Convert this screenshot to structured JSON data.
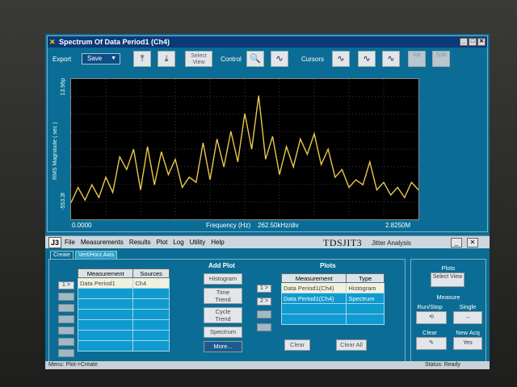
{
  "window": {
    "title": "Spectrum Of Data Period1 (Ch4)",
    "controls": [
      "_",
      "□",
      "✕"
    ]
  },
  "toolbar": {
    "export_label": "Export",
    "export_value": "Save",
    "select_view": "Select View",
    "control_label": "Control",
    "cursors_label": "Cursors",
    "var_label": "Var",
    "split_label": "Split"
  },
  "chart_data": {
    "type": "line",
    "xlabel": "Frequency (Hz)",
    "x_scale": "262.50kHz/div",
    "x_start": "0.0000",
    "x_end": "2.8250M",
    "ylabel": "RMS Magnitude ( sec )",
    "y_top": "13.96p",
    "y_bottom": "-553.3f",
    "grid": true,
    "series_color": "#e8c84a",
    "x": [
      0,
      2,
      4,
      6,
      8,
      10,
      12,
      14,
      16,
      18,
      20,
      22,
      24,
      26,
      28,
      30,
      32,
      34,
      36,
      38,
      40,
      42,
      44,
      46,
      48,
      50,
      52,
      54,
      56,
      58,
      60,
      62,
      64,
      66,
      68,
      70,
      72,
      74,
      76,
      78,
      80,
      82,
      84,
      86,
      88,
      90,
      92,
      94,
      96,
      98,
      100
    ],
    "values": [
      0.08,
      0.2,
      0.1,
      0.22,
      0.12,
      0.28,
      0.16,
      0.44,
      0.34,
      0.5,
      0.18,
      0.52,
      0.22,
      0.48,
      0.3,
      0.42,
      0.2,
      0.28,
      0.24,
      0.55,
      0.26,
      0.58,
      0.36,
      0.64,
      0.4,
      0.78,
      0.5,
      0.92,
      0.42,
      0.6,
      0.3,
      0.52,
      0.36,
      0.58,
      0.46,
      0.62,
      0.38,
      0.5,
      0.28,
      0.34,
      0.2,
      0.26,
      0.22,
      0.4,
      0.18,
      0.24,
      0.14,
      0.2,
      0.12,
      0.24,
      0.18
    ]
  },
  "menubar": {
    "logo": "J3",
    "items": [
      "File",
      "Measurements",
      "Results",
      "Plot",
      "Log",
      "Utility",
      "Help"
    ],
    "brand": "TDSJIT3",
    "brand_sub": "Jitter Analysis"
  },
  "tabs": [
    "Create",
    "Vert/Horz Axis"
  ],
  "measurements": {
    "headers": [
      "Measurement",
      "Sources"
    ],
    "rows": [
      [
        "Data Period1",
        "Ch4"
      ],
      [
        "",
        ""
      ],
      [
        "",
        ""
      ],
      [
        "",
        ""
      ],
      [
        "",
        ""
      ],
      [
        "",
        ""
      ],
      [
        "",
        ""
      ]
    ],
    "row_select": [
      "1 >"
    ]
  },
  "add_plot": {
    "title": "Add Plot",
    "buttons": [
      "Histogram",
      "Time Trend",
      "Cycle Trend",
      "Spectrum",
      "More..."
    ]
  },
  "plots": {
    "title": "Plots",
    "headers": [
      "Measurement",
      "Type"
    ],
    "rows": [
      [
        "Data Period1(Ch4)",
        "Histogram"
      ],
      [
        "Data Period1(Ch4)",
        "Spectrum"
      ],
      [
        "",
        ""
      ],
      [
        "",
        ""
      ]
    ],
    "row_select": [
      "1 >",
      "2 >"
    ],
    "clear": "Clear",
    "clear_all": "Clear All"
  },
  "right_panel": {
    "plots_title": "Plots",
    "select_view": "Select View",
    "measure_title": "Measure",
    "run_stop": "Run/Stop",
    "single": "Single",
    "clear": "Clear",
    "new_acq": "New Acq",
    "yes": "Yes"
  },
  "status": {
    "menu": "Menu: Plot->Create",
    "status": "Status:  Ready"
  }
}
